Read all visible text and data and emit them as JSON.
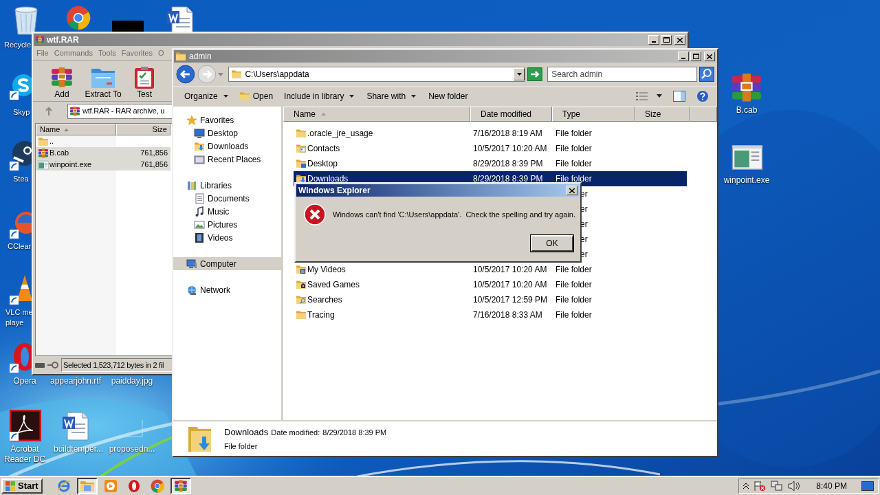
{
  "desktop_icons": [
    {
      "kind": "recycle_bin",
      "label_lines": [
        "Recycle"
      ]
    },
    {
      "kind": "chrome"
    },
    {
      "kind": "black_tile"
    },
    {
      "kind": "word_doc"
    },
    {
      "kind": "skype",
      "label_lines": [
        "Skyp"
      ]
    },
    {
      "kind": "steam",
      "label_lines": [
        "Stea"
      ]
    },
    {
      "kind": "ccleaner",
      "label_lines": [
        "CClear"
      ]
    },
    {
      "kind": "vlc",
      "label_lines": [
        "VLC me",
        "playe"
      ]
    },
    {
      "kind": "opera",
      "label_lines": [
        "Opera"
      ]
    },
    {
      "kind": "covered",
      "label_lines": [
        "appearjohn.rtf"
      ]
    },
    {
      "kind": "covered",
      "label_lines": [
        "paidday.jpg"
      ]
    },
    {
      "kind": "acrobat",
      "label_lines": [
        "Acrobat",
        "Reader DC"
      ]
    },
    {
      "kind": "word_doc",
      "label_lines": [
        "buildtemper..."
      ]
    },
    {
      "kind": "blank_file",
      "label_lines": [
        "proposedn..."
      ]
    },
    {
      "kind": "rar",
      "label_lines": [
        "B.cab"
      ]
    },
    {
      "kind": "exe",
      "label_lines": [
        "winpoint.exe"
      ]
    }
  ],
  "winrar": {
    "title": "wtf.RAR",
    "menu": [
      "File",
      "Commands",
      "Tools",
      "Favorites",
      "O"
    ],
    "toolbar": [
      {
        "kind": "add",
        "label": "Add"
      },
      {
        "kind": "extract",
        "label": "Extract To"
      },
      {
        "kind": "test",
        "label": "Test"
      }
    ],
    "path": "wtf.RAR - RAR archive, u",
    "columns": [
      {
        "label": "Name",
        "sorted": true
      },
      {
        "label": "Size",
        "sorted": false
      }
    ],
    "rows": [
      {
        "kind": "up",
        "name": "..",
        "selected": false
      },
      {
        "kind": "rar",
        "name": "B.cab",
        "size": "761,856",
        "selected": true
      },
      {
        "kind": "exe",
        "name": "winpoint.exe",
        "size": "761,856",
        "selected": true
      }
    ],
    "status": "Selected 1,523,712 bytes in 2 fil"
  },
  "explorer": {
    "title": "admin",
    "address": "C:\\Users\\appdata",
    "search_placeholder": "Search admin",
    "toolbar": [
      {
        "kind": "menu",
        "label": "Organize"
      },
      {
        "kind": "open",
        "label": "Open"
      },
      {
        "kind": "menu",
        "label": "Include in library"
      },
      {
        "kind": "menu",
        "label": "Share with"
      },
      {
        "kind": "plain",
        "label": "New folder"
      }
    ],
    "nav": [
      {
        "kind": "star",
        "label": "Favorites",
        "selected": false,
        "children": [
          {
            "kind": "desktop",
            "label": "Desktop",
            "selected": false
          },
          {
            "kind": "downloads",
            "label": "Downloads",
            "selected": false
          },
          {
            "kind": "recent",
            "label": "Recent Places",
            "selected": false
          }
        ]
      },
      {
        "kind": "library",
        "label": "Libraries",
        "selected": false,
        "children": [
          {
            "kind": "documents",
            "label": "Documents",
            "selected": false
          },
          {
            "kind": "music",
            "label": "Music",
            "selected": false
          },
          {
            "kind": "pictures",
            "label": "Pictures",
            "selected": false
          },
          {
            "kind": "videos",
            "label": "Videos",
            "selected": false
          }
        ]
      },
      {
        "kind": "computer",
        "label": "Computer",
        "selected": true
      },
      {
        "kind": "network",
        "label": "Network",
        "selected": false
      }
    ],
    "columns": [
      {
        "label": "Name",
        "sorted": true
      },
      {
        "label": "Date modified",
        "sorted": false
      },
      {
        "label": "Type",
        "sorted": false
      },
      {
        "label": "Size",
        "sorted": false
      }
    ],
    "rows": [
      {
        "kind": "folder",
        "name": ".oracle_jre_usage",
        "date": "7/16/2018 8:19 AM",
        "type": "File folder",
        "selected": false
      },
      {
        "kind": "contacts",
        "name": "Contacts",
        "date": "10/5/2017 10:20 AM",
        "type": "File folder",
        "selected": false
      },
      {
        "kind": "desktop",
        "name": "Desktop",
        "date": "8/29/2018 8:39 PM",
        "type": "File folder",
        "selected": false
      },
      {
        "kind": "downloads",
        "name": "Downloads",
        "date": "8/29/2018 8:39 PM",
        "type": "File folder",
        "selected": true
      },
      {
        "kind": "covered",
        "type": "er",
        "selected": false
      },
      {
        "kind": "covered",
        "type": "er",
        "selected": false
      },
      {
        "kind": "covered",
        "type": "er",
        "selected": false
      },
      {
        "kind": "covered",
        "type": "er",
        "selected": false
      },
      {
        "kind": "covered",
        "type": "er",
        "selected": false
      },
      {
        "kind": "videos",
        "name": "My Videos",
        "date": "10/5/2017 10:20 AM",
        "type": "File folder",
        "selected": false
      },
      {
        "kind": "games",
        "name": "Saved Games",
        "date": "10/5/2017 10:20 AM",
        "type": "File folder",
        "selected": false
      },
      {
        "kind": "searches",
        "name": "Searches",
        "date": "10/5/2017 12:59 PM",
        "type": "File folder",
        "selected": false
      },
      {
        "kind": "folder",
        "name": "Tracing",
        "date": "7/16/2018 8:33 AM",
        "type": "File folder",
        "selected": false
      }
    ],
    "details": {
      "name": "Downloads",
      "date_label": "Date modified:",
      "date": "8/29/2018 8:39 PM",
      "type": "File folder"
    }
  },
  "dialog": {
    "title": "Windows Explorer",
    "message": "Windows can't find 'C:\\Users\\appdata'.  Check the spelling and try again.",
    "button": "OK"
  },
  "taskbar": {
    "start": "Start",
    "items": [
      {
        "kind": "ie",
        "active": false
      },
      {
        "kind": "explorer",
        "active": true
      },
      {
        "kind": "media",
        "active": false
      },
      {
        "kind": "opera",
        "active": false
      },
      {
        "kind": "chrome",
        "active": false
      },
      {
        "kind": "winrar",
        "active": true
      }
    ],
    "time": "8:40 PM"
  }
}
